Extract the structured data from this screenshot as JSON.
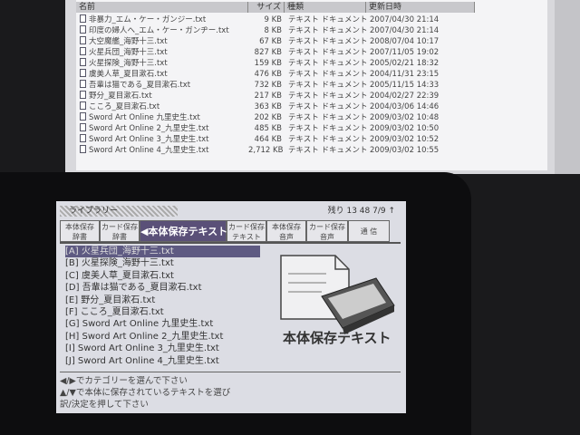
{
  "explorer": {
    "columns": [
      "名前",
      "サイズ",
      "種類",
      "更新日時"
    ],
    "files": [
      {
        "name": "非暴力_エム・ケー・ガンジー.txt",
        "size": "9 KB",
        "type": "テキスト ドキュメント",
        "date": "2007/04/30 21:14"
      },
      {
        "name": "印度の婦人へ_エム・ケー・ガンヂー.txt",
        "size": "8 KB",
        "type": "テキスト ドキュメント",
        "date": "2007/04/30 21:14"
      },
      {
        "name": "大空魔艦_海野十三.txt",
        "size": "67 KB",
        "type": "テキスト ドキュメント",
        "date": "2008/07/04 10:17"
      },
      {
        "name": "火星兵団_海野十三.txt",
        "size": "827 KB",
        "type": "テキスト ドキュメント",
        "date": "2007/11/05 19:02"
      },
      {
        "name": "火星探険_海野十三.txt",
        "size": "159 KB",
        "type": "テキスト ドキュメント",
        "date": "2005/02/21 18:32"
      },
      {
        "name": "虞美人草_夏目漱石.txt",
        "size": "476 KB",
        "type": "テキスト ドキュメント",
        "date": "2004/11/31 23:15"
      },
      {
        "name": "吾輩は猫である_夏目漱石.txt",
        "size": "732 KB",
        "type": "テキスト ドキュメント",
        "date": "2005/11/15 14:33"
      },
      {
        "name": "野分_夏目漱石.txt",
        "size": "217 KB",
        "type": "テキスト ドキュメント",
        "date": "2004/02/27 22:39"
      },
      {
        "name": "こころ_夏目漱石.txt",
        "size": "363 KB",
        "type": "テキスト ドキュメント",
        "date": "2004/03/06 14:46"
      },
      {
        "name": "Sword Art Online 九里史生.txt",
        "size": "202 KB",
        "type": "テキスト ドキュメント",
        "date": "2009/03/02 10:48"
      },
      {
        "name": "Sword Art Online 2_九里史生.txt",
        "size": "485 KB",
        "type": "テキスト ドキュメント",
        "date": "2009/03/02 10:50"
      },
      {
        "name": "Sword Art Online 3_九里史生.txt",
        "size": "464 KB",
        "type": "テキスト ドキュメント",
        "date": "2009/03/02 10:52"
      },
      {
        "name": "Sword Art Online 4_九里史生.txt",
        "size": "2,712 KB",
        "type": "テキスト ドキュメント",
        "date": "2009/03/02 10:55"
      }
    ]
  },
  "device": {
    "title": "ライブラリー",
    "status": "残り 13 48 7/9 ↑",
    "tabs": [
      "本体保存\n辞書",
      "カード保存\n辞書",
      "◀本体保存テキスト▶",
      "カード保存\nテキスト",
      "本体保存\n音声",
      "カード保存\n音声",
      "通 信"
    ],
    "items": [
      "[A] 火星兵団_海野十三.txt",
      "[B] 火星探険_海野十三.txt",
      "[C] 虞美人草_夏目漱石.txt",
      "[D] 吾輩は猫である_夏目漱石.txt",
      "[E] 野分_夏目漱石.txt",
      "[F] こころ_夏目漱石.txt",
      "[G] Sword Art Online 九里史生.txt",
      "[H] Sword Art Online 2_九里史生.txt",
      "[I] Sword Art Online 3_九里史生.txt",
      "[J] Sword Art Online 4_九里史生.txt"
    ],
    "illustration_title": "本体保存テキスト",
    "help": [
      "◀/▶でカテゴリーを選んで下さい",
      "▲/▼で本体に保存されているテキストを選び",
      "訳/決定を押して下さい"
    ]
  }
}
